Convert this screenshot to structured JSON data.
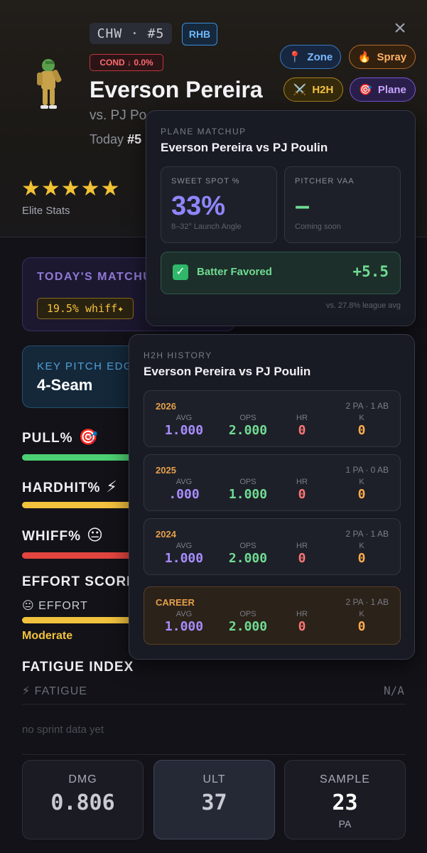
{
  "header": {
    "team": "CHW · #5",
    "hand": "RHB",
    "cond": "COND ↓ 0.0%",
    "player_name": "Everson Pereira",
    "vs_line": "vs. PJ Po",
    "today_prefix": "Today",
    "today_rank": "#5",
    "close_icon": "×",
    "stars": "★★★★★",
    "stars_label": "Elite Stats",
    "tabs": [
      {
        "icon": "📍",
        "label": "Zone"
      },
      {
        "icon": "🔥",
        "label": "Spray"
      },
      {
        "icon": "⚔️",
        "label": "H2H"
      },
      {
        "icon": "🎯",
        "label": "Plane"
      }
    ]
  },
  "body": {
    "matchup_title": "TODAY'S MATCHU",
    "whiff_chip": "19.5% whiff✦",
    "keypitch_title": "KEY PITCH EDG",
    "keypitch_value": "4-Seam",
    "metrics": [
      {
        "label": "PULL%",
        "emoji": "🎯",
        "color": "#4ccf73"
      },
      {
        "label": "HARDHIT%",
        "emoji": "⚡",
        "color": "#f2c23e"
      },
      {
        "label": "WHIFF%",
        "emoji": "😐",
        "color": "#e2453f"
      }
    ],
    "effort_title": "EFFORT SCORE",
    "effort_row": "😐 EFFORT",
    "effort_level": "Moderate",
    "fatigue_title": "FATIGUE INDEX",
    "fatigue_row": "⚡ FATIGUE",
    "fatigue_value": "N/A",
    "sprint_note": "no sprint data yet",
    "stats": [
      {
        "label": "DMG",
        "value": "0.806",
        "sub": ""
      },
      {
        "label": "ULT",
        "value": "37",
        "sub": ""
      },
      {
        "label": "SAMPLE",
        "value": "23",
        "sub": "PA"
      }
    ]
  },
  "plane": {
    "kicker": "PLANE MATCHUP",
    "title": "Everson Pereira vs PJ Poulin",
    "sweet_label": "SWEET SPOT %",
    "sweet_value": "33%",
    "sweet_sub": "8–32° Launch Angle",
    "vaa_label": "PITCHER VAA",
    "vaa_value": "–",
    "vaa_sub": "Coming soon",
    "fav_check": "✓",
    "fav_text": "Batter Favored",
    "fav_value": "+5.5",
    "league_note": "vs. 27.8% league avg"
  },
  "h2h": {
    "kicker": "H2H HISTORY",
    "title": "Everson Pereira vs PJ Poulin",
    "col_heads": [
      "AVG",
      "OPS",
      "HR",
      "K"
    ],
    "seasons": [
      {
        "year": "2026",
        "meta": "2 PA · 1 AB",
        "avg": "1.000",
        "ops": "2.000",
        "hr": "0",
        "k": "0"
      },
      {
        "year": "2025",
        "meta": "1 PA · 0 AB",
        "avg": ".000",
        "ops": "1.000",
        "hr": "0",
        "k": "0"
      },
      {
        "year": "2024",
        "meta": "2 PA · 1 AB",
        "avg": "1.000",
        "ops": "2.000",
        "hr": "0",
        "k": "0"
      },
      {
        "year": "CAREER",
        "meta": "2 PA · 1 AB",
        "avg": "1.000",
        "ops": "2.000",
        "hr": "0",
        "k": "0"
      }
    ]
  }
}
